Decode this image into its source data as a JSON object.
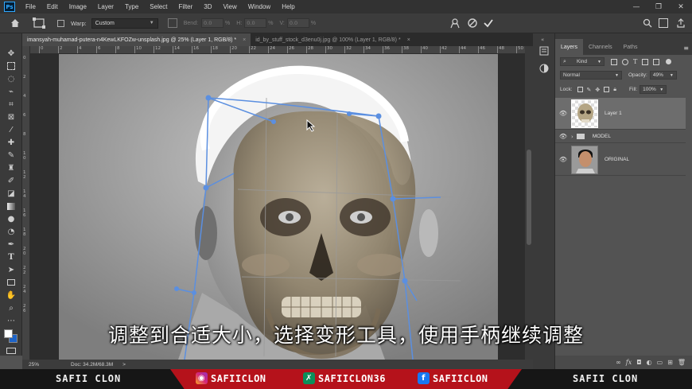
{
  "app": {
    "logo": "Ps"
  },
  "menu": [
    "File",
    "Edit",
    "Image",
    "Layer",
    "Type",
    "Select",
    "Filter",
    "3D",
    "View",
    "Window",
    "Help"
  ],
  "window_controls": [
    "—",
    "❐",
    "✕"
  ],
  "options_bar": {
    "warp_label": "Warp:",
    "warp_value": "Custom",
    "bend_label": "Bend:",
    "bend_value": "0.0",
    "unit_pct": "%",
    "h_label": "H:",
    "h_value": "0.0",
    "v_label": "V:",
    "v_value": "0.0"
  },
  "tabs": [
    {
      "label": "imansyah-muhamad-putera-n4KewLKFOZw-unsplash.jpg @ 25% (Layer 1, RGB/8) *",
      "close": "×"
    },
    {
      "label": "id_by_stuff_stock_d3enu0j.jpg @ 100% (Layer 1, RGB/8) *",
      "close": "×"
    }
  ],
  "ruler_top": [
    "0",
    "2",
    "4",
    "6",
    "8",
    "10",
    "12",
    "14",
    "16",
    "18",
    "20",
    "22",
    "24",
    "26",
    "28",
    "30",
    "32",
    "34",
    "36",
    "38",
    "40",
    "42",
    "44",
    "46",
    "48",
    "50"
  ],
  "ruler_left": [
    "0",
    "2",
    "4",
    "6",
    "8",
    "1\n0",
    "1\n2",
    "1\n4",
    "1\n6",
    "1\n8",
    "2\n0",
    "2\n2",
    "2\n4",
    "2\n6"
  ],
  "status": {
    "zoom": "25%",
    "doc": "Doc: 34.2M/68.3M",
    "arrow": ">"
  },
  "panel": {
    "tabs": [
      "Layers",
      "Channels",
      "Paths"
    ],
    "kind_label": "Kind",
    "blend_mode": "Normal",
    "opacity_label": "Opacity:",
    "opacity_value": "49%",
    "lock_label": "Lock:",
    "fill_label": "Fill:",
    "fill_value": "100%",
    "layers": [
      {
        "name": "Layer 1",
        "type": "layer",
        "selected": true
      },
      {
        "name": "MODEL",
        "type": "group",
        "selected": false
      },
      {
        "name": "ORIGINAL",
        "type": "layer",
        "selected": false
      }
    ]
  },
  "subtitle": "调整到合适大小，选择变形工具，使用手柄继续调整",
  "banner": {
    "left_name": "SAFII CLON",
    "instagram": "SAFIICLON",
    "xing": "SAFIICLON36",
    "facebook": "SAFIICLON",
    "right_name": "SAFII CLON",
    "icons": {
      "instagram": "◉",
      "xing": "✗",
      "facebook": "f"
    }
  },
  "colors": {
    "accent": "#5b8fe0",
    "banner_red": "#b5121b",
    "ps_blue": "#31a8ff",
    "instagram": "#d62976",
    "xing": "#0a8f5a",
    "facebook": "#1877f2"
  }
}
